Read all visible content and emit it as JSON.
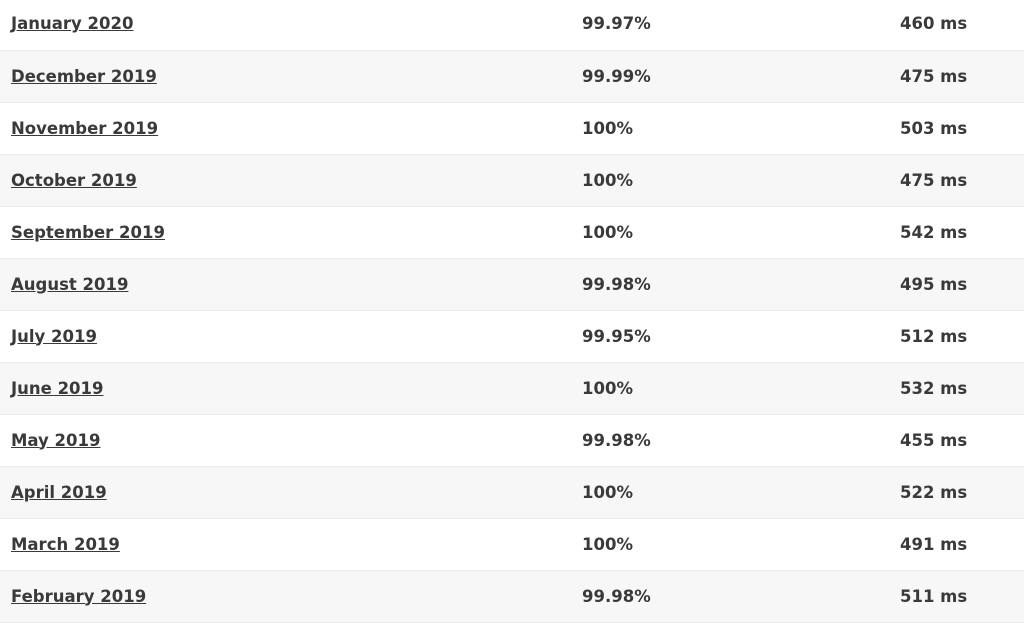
{
  "rows": [
    {
      "month": "January 2020",
      "uptime": "99.97%",
      "response": "460 ms"
    },
    {
      "month": "December 2019",
      "uptime": "99.99%",
      "response": "475 ms"
    },
    {
      "month": "November 2019",
      "uptime": "100%",
      "response": "503 ms"
    },
    {
      "month": "October 2019",
      "uptime": "100%",
      "response": "475 ms"
    },
    {
      "month": "September 2019",
      "uptime": "100%",
      "response": "542 ms"
    },
    {
      "month": "August 2019",
      "uptime": "99.98%",
      "response": "495 ms"
    },
    {
      "month": "July 2019",
      "uptime": "99.95%",
      "response": "512 ms"
    },
    {
      "month": "June 2019",
      "uptime": "100%",
      "response": "532 ms"
    },
    {
      "month": "May 2019",
      "uptime": "99.98%",
      "response": "455 ms"
    },
    {
      "month": "April 2019",
      "uptime": "100%",
      "response": "522 ms"
    },
    {
      "month": "March 2019",
      "uptime": "100%",
      "response": "491 ms"
    },
    {
      "month": "February 2019",
      "uptime": "99.98%",
      "response": "511 ms"
    }
  ]
}
